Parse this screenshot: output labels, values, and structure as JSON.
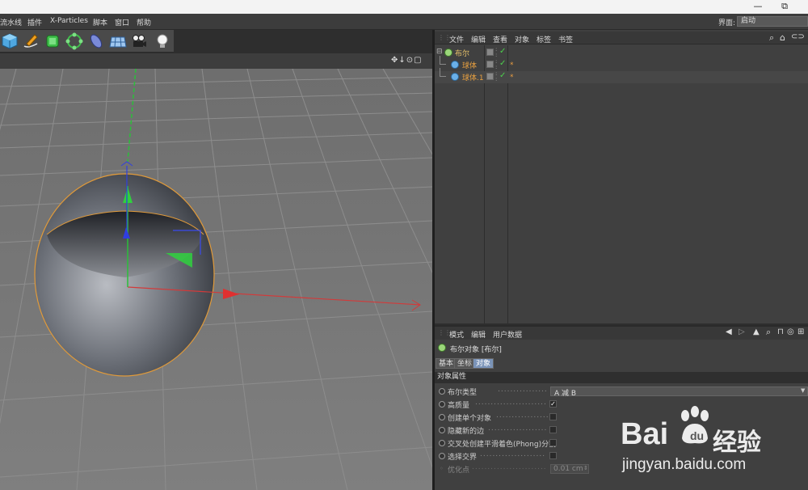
{
  "window": {
    "minimize_label": "—",
    "restore_label": "⧉"
  },
  "menubar": {
    "items": [
      "流水线",
      "插件",
      "X-Particles",
      "脚本",
      "窗口",
      "帮助"
    ],
    "interface_label": "界面:",
    "interface_value": "启动"
  },
  "toolbar": {
    "icons": [
      "cube-icon",
      "pen-icon",
      "subdivision-icon",
      "array-icon",
      "deformer-icon",
      "floor-grid-icon",
      "camera-icon",
      "light-icon"
    ]
  },
  "viewport": {
    "nav_glyphs": "✥↓⊙▢"
  },
  "object_manager": {
    "menu": [
      "文件",
      "编辑",
      "查看",
      "对象",
      "标签",
      "书签"
    ],
    "objects": [
      {
        "name": "布尔",
        "depth": 0,
        "color": "#e8c26a"
      },
      {
        "name": "球体",
        "depth": 1,
        "color": "#e8a040"
      },
      {
        "name": "球体.1",
        "depth": 1,
        "color": "#e8a040"
      }
    ]
  },
  "attributes": {
    "menu": [
      "模式",
      "编辑",
      "用户数据"
    ],
    "title": "布尔对象 [布尔]",
    "tabs": [
      "基本",
      "坐标",
      "对象"
    ],
    "active_tab": "对象",
    "section": "对象属性",
    "props": [
      {
        "label": "布尔类型",
        "type": "select",
        "value": "A 减 B"
      },
      {
        "label": "高质量",
        "type": "check",
        "checked": true
      },
      {
        "label": "创建单个对象",
        "type": "check",
        "checked": false
      },
      {
        "label": "隐藏新的边",
        "type": "check",
        "checked": false
      },
      {
        "label": "交叉处创建平滑着色(Phong)分割",
        "type": "check",
        "checked": false
      },
      {
        "label": "选择交界",
        "type": "check",
        "checked": false
      },
      {
        "label": "优化点",
        "type": "number",
        "value": "0.01 cm"
      }
    ]
  },
  "watermark": {
    "brand": "Bai",
    "brand2": "经验",
    "url": "jingyan.baidu.com"
  }
}
